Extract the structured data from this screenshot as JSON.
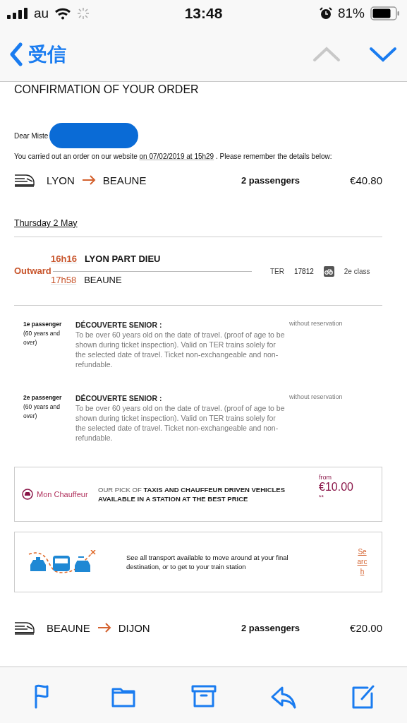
{
  "status_bar": {
    "carrier": "au",
    "time": "13:48",
    "battery": "81%"
  },
  "nav": {
    "back_label": "受信",
    "previous_disabled": true,
    "next_disabled": false
  },
  "email": {
    "title": "CONFIRMATION OF YOUR ORDER",
    "greeting": "Dear Miste",
    "order_before": "You carried out an order on our website ",
    "order_link": "on 07/02/2019 at 15h29",
    "order_after": " . Please remember the details below:",
    "journeys": [
      {
        "from": "LYON",
        "to": "BEAUNE",
        "passengers": "2 passengers",
        "price": "€40.80"
      }
    ],
    "date": "Thursday 2 May",
    "leg": {
      "label": "Outward",
      "departure_time": "16h16",
      "departure_station": "LYON PART DIEU",
      "arrival_time": "17h58",
      "arrival_station": "BEAUNE",
      "train_type": "TER",
      "train_number": "17812",
      "class": "2e class"
    },
    "passengers": [
      {
        "label": "1e passenger",
        "note": "(60 years and over)",
        "fare": "DÉCOUVERTE SENIOR :",
        "description": "To be over 60 years old on the date of travel. (proof of age to be shown during ticket inspection). Valid on TER trains solely for the selected date of travel. Ticket non-exchangeable and non-refundable.",
        "reservation": "without reservation"
      },
      {
        "label": "2e passenger",
        "note": "(60 years and over)",
        "fare": "DÉCOUVERTE SENIOR :",
        "description": "To be over 60 years old on the date of travel. (proof of age to be shown during ticket inspection). Valid on TER trains solely for the selected date of travel. Ticket non-exchangeable and non-refundable.",
        "reservation": "without reservation"
      }
    ],
    "chauffeur": {
      "brand": "Mon Chauffeur",
      "text": "OUR PICK OF **TAXIS AND CHAUFFEUR DRIVEN VEHICLES AVAILABLE IN A STATION AT THE BEST PRICE**",
      "from": "from",
      "price": "€10.00",
      "footnote": "**"
    },
    "transport": {
      "text": "See all transport available to move around at your final destination, or to get to your train station",
      "link": "Search"
    },
    "next_journey": {
      "from": "BEAUNE",
      "to": "DIJON",
      "passengers": "2 passengers",
      "price": "€20.00"
    }
  }
}
